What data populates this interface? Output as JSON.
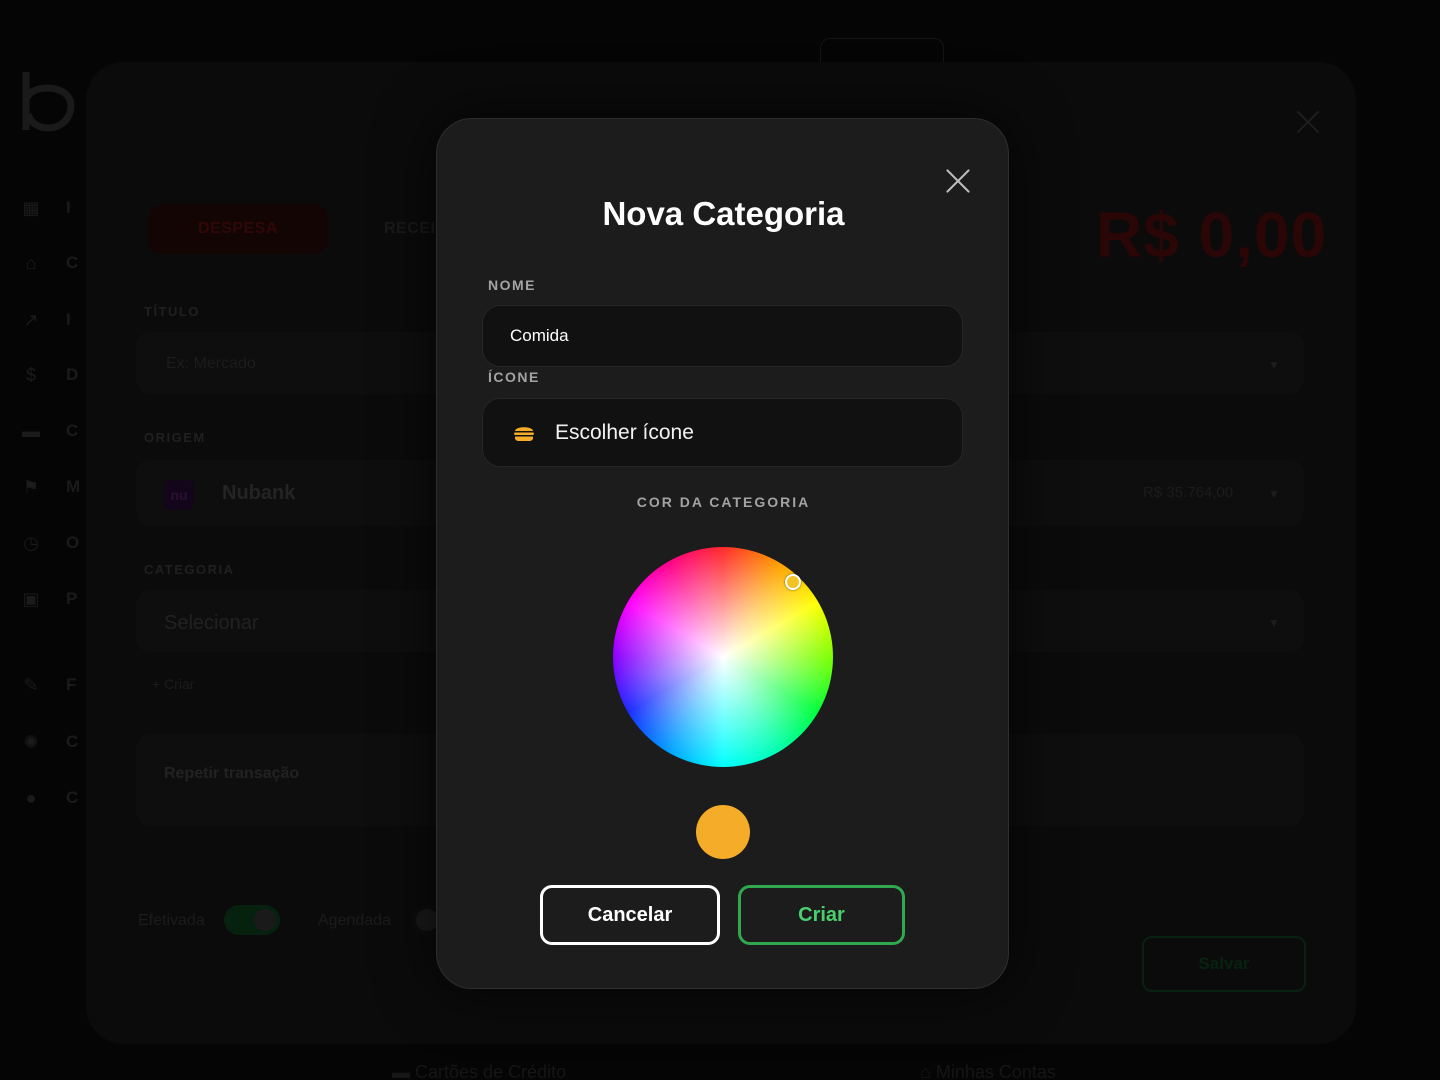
{
  "background": {
    "sidebar_items": [
      {
        "icon": "grid-icon",
        "glyph": "▦",
        "label": "I"
      },
      {
        "icon": "bank-icon",
        "glyph": "⌂",
        "label": "C"
      },
      {
        "icon": "trend-icon",
        "glyph": "↗",
        "label": "I"
      },
      {
        "icon": "dollar-icon",
        "glyph": "$",
        "label": "D"
      },
      {
        "icon": "card-icon",
        "glyph": "▬",
        "label": "C"
      },
      {
        "icon": "flag-icon",
        "glyph": "⚑",
        "label": "M"
      },
      {
        "icon": "clock-icon",
        "glyph": "◷",
        "label": "O"
      },
      {
        "icon": "calendar-icon",
        "glyph": "▣",
        "label": "P"
      },
      {
        "icon": "wrench-icon",
        "glyph": "✎",
        "label": "F"
      },
      {
        "icon": "gear-icon",
        "glyph": "✺",
        "label": "C"
      },
      {
        "icon": "globe-icon",
        "glyph": "●",
        "label": "C"
      }
    ],
    "tabs": {
      "despesa": "DESPESA",
      "receita": "RECEI"
    },
    "amount": "R$ 0,00",
    "titulo_label": "TÍTULO",
    "titulo_placeholder": "Ex: Mercado",
    "origem_label": "ORIGEM",
    "origem_badge": "nu",
    "origem_value": "Nubank",
    "origem_balance": "R$ 35.764,00",
    "categoria_label": "CATEGORIA",
    "categoria_value": "Selecionar",
    "criar_link": "+ Criar",
    "repetir_label": "Repetir transação",
    "efetivada_label": "Efetivada",
    "agendada_label": "Agendada",
    "save_label": "Salvar",
    "bottom_left": "Cartões de Crédito",
    "bottom_right": "Minhas Contas",
    "caret": "▼"
  },
  "dialog": {
    "title": "Nova Categoria",
    "nome_label": "NOME",
    "nome_value": "Comida",
    "icone_label": "ÍCONE",
    "icone_button": "Escolher ícone",
    "icone_selected": "hamburger-icon",
    "cor_label": "COR DA CATEGORIA",
    "selected_color": "#f5ac28",
    "cancel_label": "Cancelar",
    "create_label": "Criar"
  },
  "colors": {
    "accent_green": "#2fa84f",
    "expense_red": "#2a0606",
    "swatch": "#f5ac28"
  }
}
